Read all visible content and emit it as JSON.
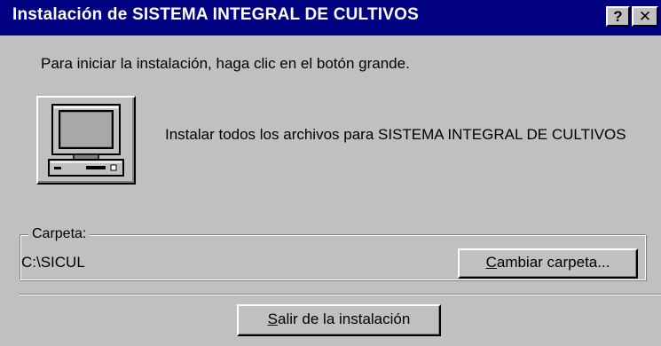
{
  "window": {
    "title": "Instalación de SISTEMA INTEGRAL DE CULTIVOS",
    "help_label": "?",
    "close_label": "✕"
  },
  "main": {
    "intro": "Para iniciar la instalación, haga clic en el botón grande.",
    "install_description": "Instalar todos los archivos para SISTEMA INTEGRAL DE CULTIVOS",
    "install_icon": "computer-icon"
  },
  "folder": {
    "label": "Carpeta:",
    "path": "C:\\SICUL",
    "change_button": {
      "mnemonic": "C",
      "rest": "ambiar carpeta..."
    }
  },
  "exit_button": {
    "mnemonic": "S",
    "rest": "alir de la instalación"
  }
}
